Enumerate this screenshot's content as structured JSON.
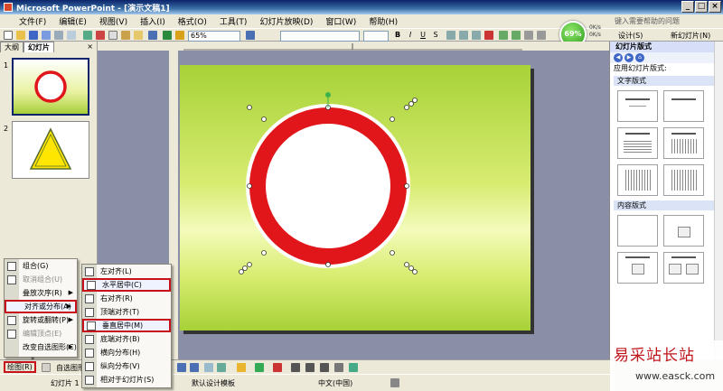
{
  "window": {
    "title": "Microsoft PowerPoint - [演示文稿1]",
    "buttons": [
      "_",
      "□",
      "×"
    ]
  },
  "menubar": {
    "items": [
      "文件(F)",
      "编辑(E)",
      "视图(V)",
      "插入(I)",
      "格式(O)",
      "工具(T)",
      "幻灯片放映(D)",
      "窗口(W)",
      "帮助(H)"
    ],
    "help_placeholder": "键入需要帮助的问题"
  },
  "toolbar": {
    "zoom": "65%",
    "font_buttons": [
      "B",
      "I",
      "U",
      "S"
    ],
    "design_label": "设计(S)",
    "new_slide_label": "新幻灯片(N)"
  },
  "gauge": {
    "percent": "69%",
    "up": "0K/s",
    "down": "0K/s"
  },
  "left_panel": {
    "tabs": [
      "大纲",
      "幻灯片"
    ],
    "close": "×",
    "slides": [
      {
        "number": "1"
      },
      {
        "number": "2"
      }
    ]
  },
  "task_pane": {
    "title": "幻灯片版式",
    "apply_label": "应用幻灯片版式:",
    "sections": [
      "文字版式",
      "内容版式"
    ]
  },
  "draw_menu": {
    "items": [
      {
        "label": "组合(G)",
        "disabled": false
      },
      {
        "label": "取消组合(U)",
        "disabled": true
      },
      {
        "label": "叠放次序(R)",
        "disabled": false
      },
      {
        "label": "对齐或分布(A)",
        "disabled": false,
        "highlighted": true
      },
      {
        "label": "旋转或翻转(P)",
        "disabled": false
      },
      {
        "label": "编辑顶点(E)",
        "disabled": true
      },
      {
        "label": "改变自选图形(C)",
        "disabled": false
      }
    ],
    "more": "»"
  },
  "align_menu": {
    "items": [
      {
        "label": "左对齐(L)"
      },
      {
        "label": "水平居中(C)",
        "highlighted": true
      },
      {
        "label": "右对齐(R)"
      },
      {
        "label": "顶端对齐(T)"
      },
      {
        "label": "垂直居中(M)",
        "highlighted": true
      },
      {
        "label": "底端对齐(B)"
      },
      {
        "label": "横向分布(H)"
      },
      {
        "label": "纵向分布(V)"
      },
      {
        "label": "相对于幻灯片(S)"
      }
    ]
  },
  "drawbar": {
    "draw_label": "绘图(R)",
    "autoshape_label": "自选图形(U)"
  },
  "status": {
    "slide": "幻灯片 1 /",
    "design": "默认设计模板",
    "language": "中文(中国)"
  },
  "watermark": {
    "cn": "易采站长站",
    "url": "www.easck.com"
  }
}
